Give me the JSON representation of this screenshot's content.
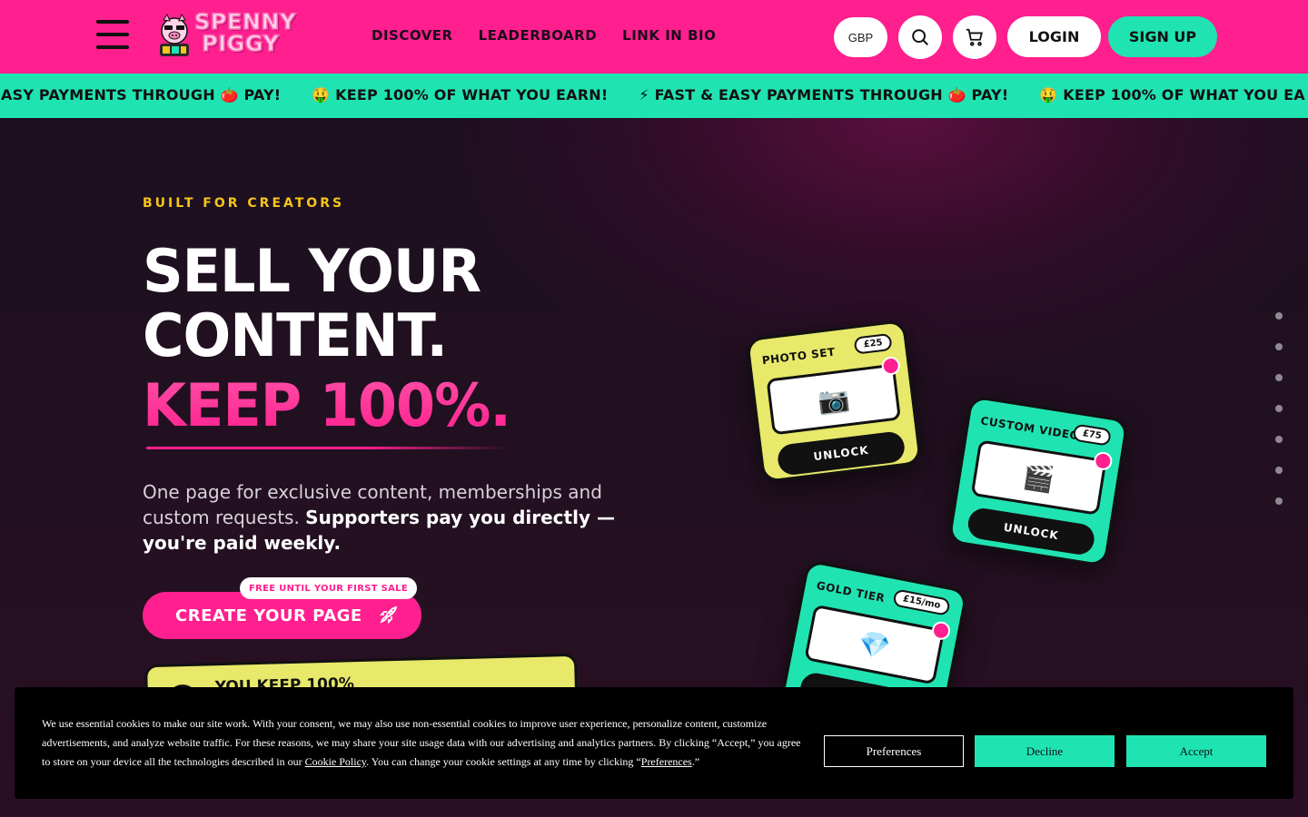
{
  "header": {
    "logo_line1": "SPENNY",
    "logo_line2": "PIGGY",
    "nav": [
      "DISCOVER",
      "LEADERBOARD",
      "LINK IN BIO"
    ],
    "currency": "GBP",
    "login_label": "LOGIN",
    "signup_label": "SIGN UP"
  },
  "ticker": {
    "items": [
      "& EASY PAYMENTS THROUGH 🍅 PAY!",
      "🤑 KEEP 100% OF WHAT YOU EARN!",
      "⚡ FAST & EASY PAYMENTS THROUGH 🍅 PAY!",
      "🤑 KEEP 100% OF WHAT YOU EA"
    ]
  },
  "hero": {
    "eyebrow": "BUILT FOR CREATORS",
    "headline_1": "SELL YOUR",
    "headline_2": "CONTENT.",
    "headline_3": "KEEP 100%.",
    "lead_plain": "One page for exclusive content, memberships and custom requests. ",
    "lead_bold": "Supporters pay you directly — you're paid weekly.",
    "cta_label": "CREATE YOUR PAGE",
    "cta_badge": "FREE UNTIL YOUR FIRST SALE",
    "keep_card_text": "YOU KEEP 100%"
  },
  "cards": [
    {
      "title": "PHOTO SET",
      "price": "£25",
      "icon": "📷",
      "action": "UNLOCK"
    },
    {
      "title": "CUSTOM VIDEO",
      "price": "£75",
      "icon": "🎬",
      "action": "UNLOCK"
    },
    {
      "title": "GOLD TIER",
      "price": "£15/mo",
      "icon": "💎",
      "action": ""
    }
  ],
  "cookie": {
    "text_before": "We use essential cookies to make our site work. With your consent, we may also use non-essential cookies to improve user experience, personalize content, customize advertisements, and analyze website traffic. For these reasons, we may share your site usage data with our advertising and analytics partners. By clicking “Accept,” you agree to store on your device all the technologies described in our ",
    "policy_link": "Cookie Policy",
    "text_middle": ". You can change your cookie settings at any time by clicking “",
    "preferences_link": "Preferences",
    "text_after": ".”",
    "preferences_label": "Preferences",
    "decline_label": "Decline",
    "accept_label": "Accept"
  },
  "colors": {
    "brand_pink": "#ff1f8e",
    "brand_mint": "#20e3b2",
    "brand_yellow": "#e8e86a",
    "eyebrow_gold": "#f5c518"
  }
}
